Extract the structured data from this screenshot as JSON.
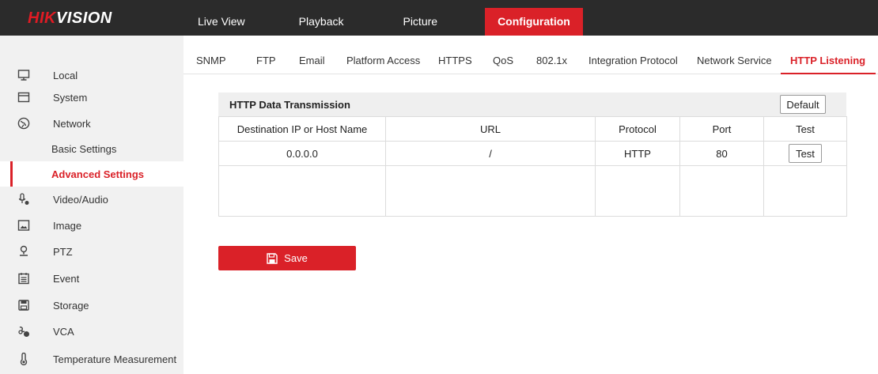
{
  "brand": {
    "prefix": "HIK",
    "suffix": "VISION"
  },
  "nav": [
    {
      "label": "Live View",
      "active": false
    },
    {
      "label": "Playback",
      "active": false
    },
    {
      "label": "Picture",
      "active": false
    },
    {
      "label": "Configuration",
      "active": true
    }
  ],
  "sidebar": {
    "items": [
      {
        "label": "Local",
        "icon": "monitor-icon"
      },
      {
        "label": "System",
        "icon": "system-icon"
      },
      {
        "label": "Network",
        "icon": "globe-icon"
      },
      {
        "label": "Basic Settings",
        "sub": true
      },
      {
        "label": "Advanced Settings",
        "sub": true,
        "active": true
      },
      {
        "label": "Video/Audio",
        "icon": "microphone-icon"
      },
      {
        "label": "Image",
        "icon": "image-icon"
      },
      {
        "label": "PTZ",
        "icon": "ptz-icon"
      },
      {
        "label": "Event",
        "icon": "calendar-icon"
      },
      {
        "label": "Storage",
        "icon": "storage-icon"
      },
      {
        "label": "VCA",
        "icon": "vca-icon"
      },
      {
        "label": "Temperature Measurement",
        "icon": "thermometer-icon"
      }
    ]
  },
  "tabs": [
    {
      "label": "SNMP"
    },
    {
      "label": "FTP"
    },
    {
      "label": "Email"
    },
    {
      "label": "Platform Access"
    },
    {
      "label": "HTTPS"
    },
    {
      "label": "QoS"
    },
    {
      "label": "802.1x"
    },
    {
      "label": "Integration Protocol"
    },
    {
      "label": "Network Service"
    },
    {
      "label": "HTTP Listening",
      "active": true
    }
  ],
  "section": {
    "title": "HTTP Data Transmission",
    "default_label": "Default",
    "columns": [
      "Destination IP or Host Name",
      "URL",
      "Protocol",
      "Port",
      "Test"
    ],
    "rows": [
      {
        "host": "0.0.0.0",
        "url": "/",
        "protocol": "HTTP",
        "port": "80",
        "test_label": "Test"
      }
    ]
  },
  "save_label": "Save",
  "colors": {
    "accent": "#da2128",
    "topbar": "#2b2b2b",
    "sidebar": "#f1f1f1"
  }
}
